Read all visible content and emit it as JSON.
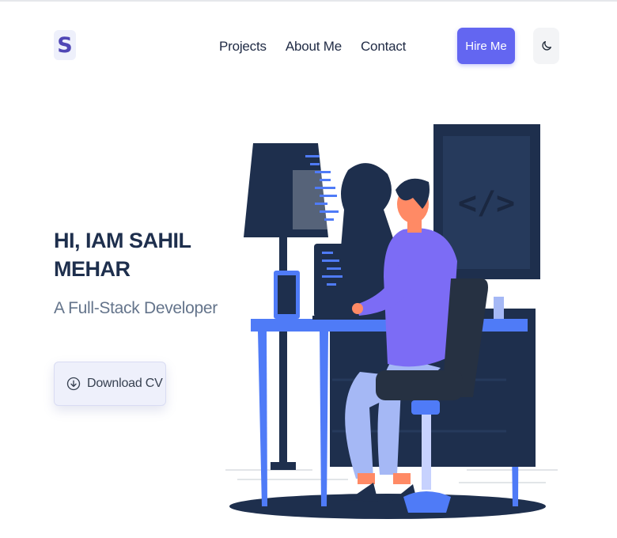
{
  "header": {
    "logo_letter": "S",
    "nav": [
      {
        "label": "Projects"
      },
      {
        "label": "About Me"
      },
      {
        "label": "Contact"
      }
    ],
    "hire_label": "Hire Me",
    "theme_icon": "moon-icon"
  },
  "hero": {
    "title": "HI, IAM SAHIL MEHAR",
    "subtitle": "A Full-Stack Developer",
    "download_label": "Download CV",
    "download_icon": "download-circle-icon"
  },
  "colors": {
    "accent": "#6366f1",
    "navy": "#1e2f4d",
    "muted": "#64748b",
    "illustration_blue": "#4f7bf7"
  }
}
